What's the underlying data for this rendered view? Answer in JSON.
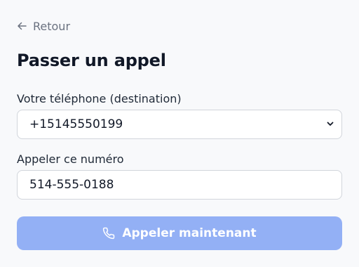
{
  "nav": {
    "back_label": "Retour",
    "back_icon": "arrow-left-icon"
  },
  "page": {
    "title": "Passer un appel"
  },
  "form": {
    "phone_label": "Votre téléphone (destination)",
    "phone_value": "+15145550199",
    "phone_icon": "chevron-down-icon",
    "number_label": "Appeler ce numéro",
    "number_value": "514-555-0188"
  },
  "actions": {
    "call_label": "Appeler maintenant",
    "call_icon": "phone-icon",
    "call_button_color": "#93b0f5"
  }
}
